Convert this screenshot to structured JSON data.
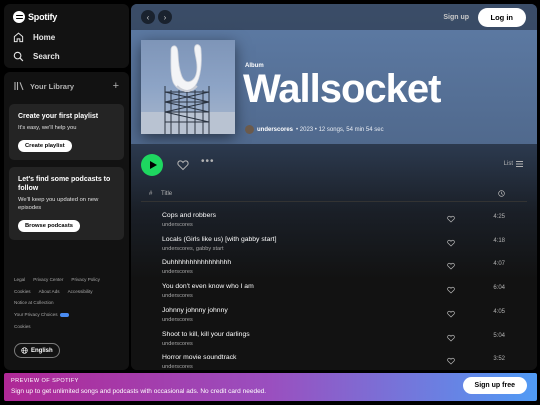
{
  "sidebar": {
    "logo_text": "Spotify",
    "nav": [
      {
        "label": "Home",
        "icon": "home-icon"
      },
      {
        "label": "Search",
        "icon": "search-icon"
      }
    ],
    "library": {
      "label": "Your Library",
      "add": "+"
    },
    "playlist_promo": {
      "title": "Create your first playlist",
      "subtitle": "It's easy, we'll help you",
      "button": "Create playlist"
    },
    "podcast_promo": {
      "title": "Let's find some podcasts to follow",
      "subtitle": "We'll keep you updated on new episodes",
      "button": "Browse podcasts"
    },
    "legal": {
      "legal": "Legal",
      "privacy_center": "Privacy Center",
      "privacy_policy": "Privacy Policy",
      "cookies": "Cookies",
      "about_ads": "About Ads",
      "accessibility": "Accessibility",
      "notice": "Notice at Collection",
      "choices": "Your Privacy Choices",
      "cookies2": "Cookies"
    },
    "language": "English"
  },
  "topbar": {
    "signup": "Sign up",
    "login": "Log in"
  },
  "album": {
    "kind": "Album",
    "title": "Wallsocket",
    "artist": "underscores",
    "details": "• 2023 • 12 songs, 54 min 54 sec"
  },
  "controls": {
    "more": "•••",
    "view": "List"
  },
  "table": {
    "hash": "#",
    "title": "Title"
  },
  "tracks": [
    {
      "name": "Cops and robbers",
      "artist": "underscores",
      "duration": "4:25"
    },
    {
      "name": "Locals (Girls like us) [with gabby start]",
      "artist": "underscores, gabby start",
      "duration": "4:18"
    },
    {
      "name": "Duhhhhhhhhhhhhhhhh",
      "artist": "underscores",
      "duration": "4:07"
    },
    {
      "name": "You don't even know who I am",
      "artist": "underscores",
      "duration": "6:04"
    },
    {
      "name": "Johnny johnny johnny",
      "artist": "underscores",
      "duration": "4:05"
    },
    {
      "name": "Shoot to kill, kill your darlings",
      "artist": "underscores",
      "duration": "5:04"
    },
    {
      "name": "Horror movie soundtrack",
      "artist": "underscores",
      "duration": "3:52"
    }
  ],
  "banner": {
    "title": "PREVIEW OF SPOTIFY",
    "subtitle": "Sign up to get unlimited songs and podcasts with occasional ads. No credit card needed.",
    "button": "Sign up free"
  },
  "colors": {
    "accent": "#1ed760",
    "hero": "#5e7ca6",
    "banner_start": "#af2896",
    "banner_end": "#509bf5"
  }
}
